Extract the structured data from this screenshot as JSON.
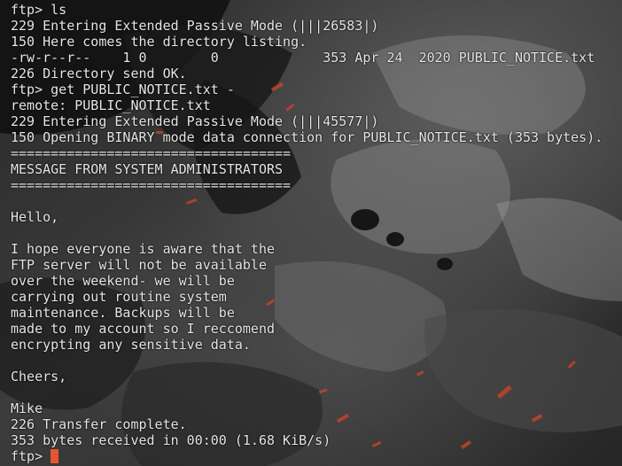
{
  "terminal": {
    "lines": [
      "ftp> ls",
      "229 Entering Extended Passive Mode (|||26583|)",
      "150 Here comes the directory listing.",
      "-rw-r--r--    1 0        0             353 Apr 24  2020 PUBLIC_NOTICE.txt",
      "226 Directory send OK.",
      "ftp> get PUBLIC_NOTICE.txt -",
      "remote: PUBLIC_NOTICE.txt",
      "229 Entering Extended Passive Mode (|||45577|)",
      "150 Opening BINARY mode data connection for PUBLIC_NOTICE.txt (353 bytes).",
      "===================================",
      "MESSAGE FROM SYSTEM ADMINISTRATORS",
      "===================================",
      "",
      "Hello,",
      "",
      "I hope everyone is aware that the",
      "FTP server will not be available",
      "over the weekend- we will be",
      "carrying out routine system",
      "maintenance. Backups will be",
      "made to my account so I reccomend",
      "encrypting any sensitive data.",
      "",
      "Cheers,",
      "",
      "Mike",
      "226 Transfer complete.",
      "353 bytes received in 00:00 (1.68 KiB/s)"
    ],
    "prompt": "ftp> ",
    "cursor_color": "#e8552c",
    "text_color": "#e6e6e6"
  }
}
